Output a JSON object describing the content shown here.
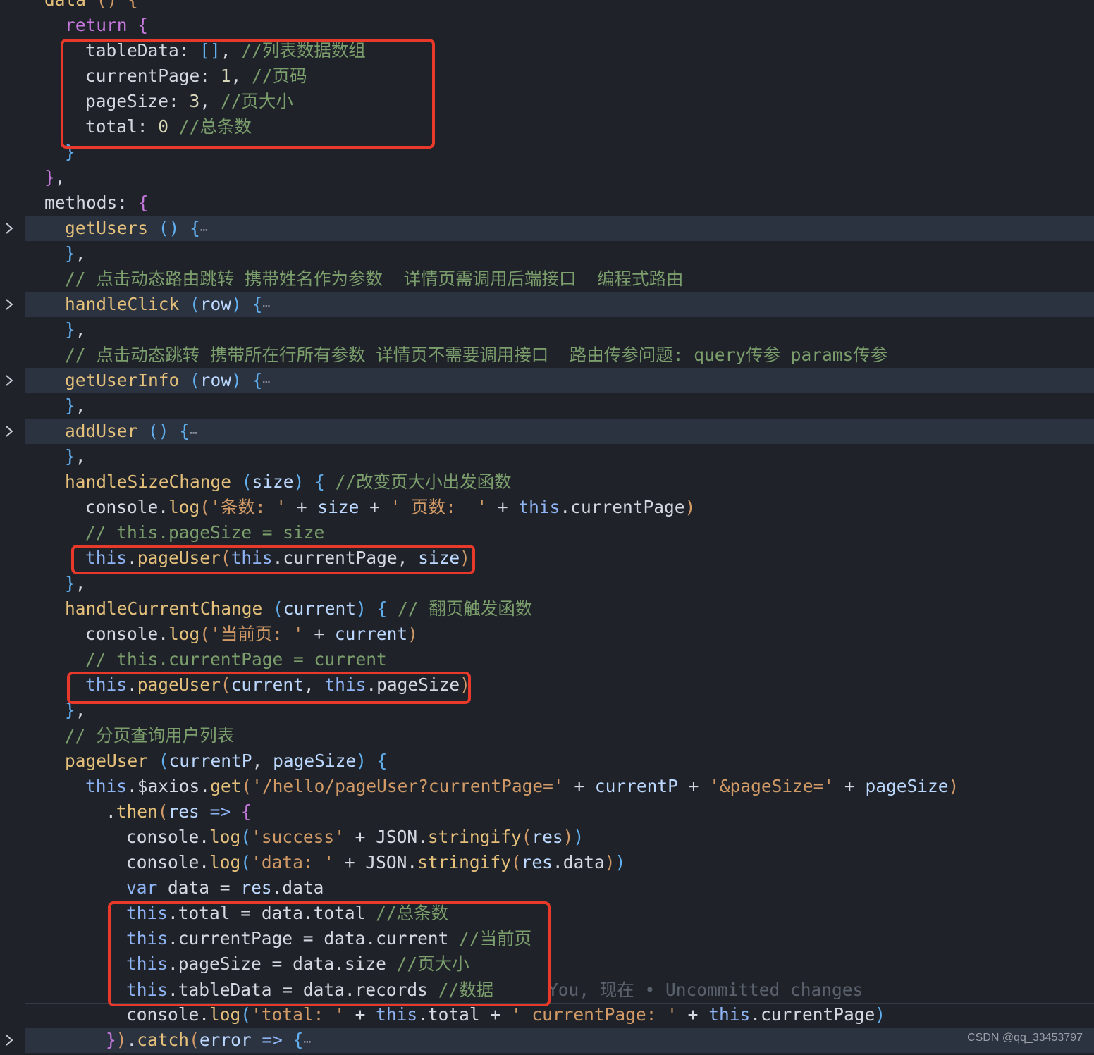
{
  "lines": [
    "data () {",
    "return {",
    "tableData: [], //列表数据数组",
    "currentPage: 1, //页码",
    "pageSize: 3, //页大小",
    "total: 0 //总条数",
    "}",
    "},",
    "methods: {",
    "getUsers () {⋯",
    "},",
    "// 点击动态路由跳转 携带姓名作为参数  详情页需调用后端接口  编程式路由",
    "handleClick (row) {⋯",
    "},",
    "// 点击动态跳转 携带所在行所有参数 详情页不需要调用接口  路由传参问题: query传参 params传参",
    "getUserInfo (row) {⋯",
    "},",
    "addUser () {⋯",
    "},",
    "handleSizeChange (size) { //改变页大小出发函数",
    "console.log('条数: ' + size + ' 页数:  ' + this.currentPage)",
    "// this.pageSize = size",
    "this.pageUser(this.currentPage, size)",
    "},",
    "handleCurrentChange (current) { // 翻页触发函数",
    "console.log('当前页: ' + current)",
    "// this.currentPage = current",
    "this.pageUser(current, this.pageSize)",
    "},",
    "// 分页查询用户列表",
    "pageUser (currentP, pageSize) {",
    "this.$axios.get('/hello/pageUser?currentPage=' + currentP + '&pageSize=' + pageSize)",
    ".then(res => {",
    "console.log('success' + JSON.stringify(res))",
    "console.log('data: ' + JSON.stringify(res.data))",
    "var data = res.data",
    "this.total = data.total //总条数",
    "this.currentPage = data.current //当前页",
    "this.pageSize = data.size //页大小",
    "this.tableData = data.records //数据",
    "console.log('total: ' + this.total + ' currentPage: ' + this.currentPage)",
    "}).catch(error => {⋯"
  ],
  "inline_blame": "You, 现在 • Uncommitted changes",
  "watermark": "CSDN @qq_33453797",
  "colors": {
    "background": "#1f2329",
    "highlight_box": "#e8392b",
    "folded_line": "#2b3340"
  }
}
